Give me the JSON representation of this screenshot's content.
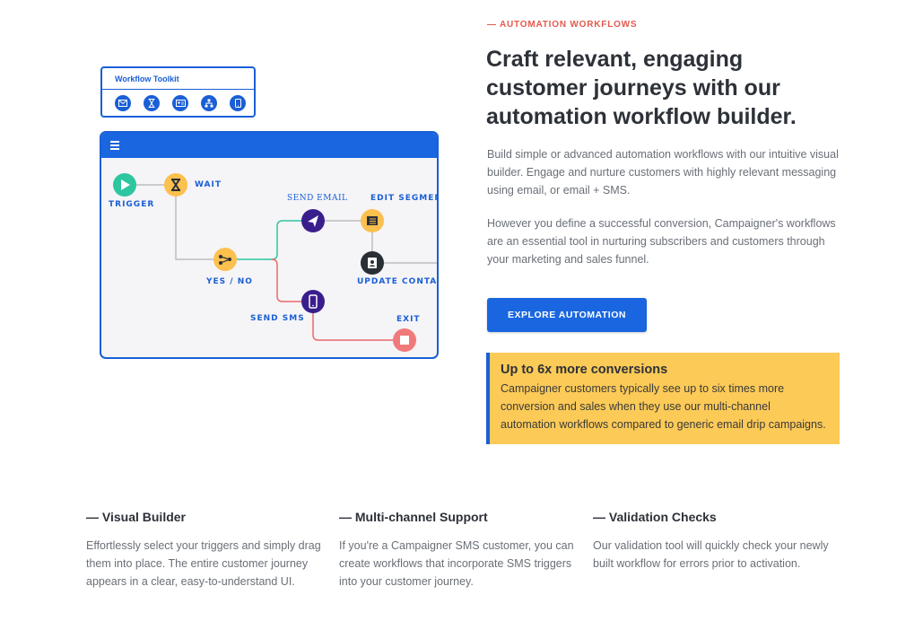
{
  "toolkit": {
    "title": "Workflow Toolkit",
    "icons": [
      "mail-icon",
      "hourglass-icon",
      "id-card-icon",
      "sitemap-icon",
      "mobile-icon"
    ]
  },
  "builder": {
    "nodes": {
      "trigger": "TRIGGER",
      "wait": "WAIT",
      "yes_no": "YES / NO",
      "send_email": "SEND EMAIL",
      "edit_segment": "EDIT SEGMENT",
      "update_contact": "UPDATE CONTACT",
      "send_sms": "SEND SMS",
      "exit": "EXIT"
    }
  },
  "content": {
    "eyebrow": "— AUTOMATION WORKFLOWS",
    "headline": "Craft relevant, engaging customer journeys with our automation workflow builder.",
    "paragraph1": "Build simple or advanced automation workflows with our intuitive visual builder. Engage and nurture customers with highly relevant messaging using email, or email + SMS.",
    "paragraph2": "However you define a successful conversion, Campaigner's workflows are an essential tool in nurturing subscribers and customers through your marketing and sales funnel.",
    "cta_label": "EXPLORE AUTOMATION"
  },
  "callout": {
    "title": "Up to 6x more conversions",
    "body": "Campaigner customers typically see up to six times more conversion and sales when they use our multi-channel automation workflows compared to generic email drip campaigns."
  },
  "features": [
    {
      "title": "— Visual Builder",
      "body": "Effortlessly select your triggers and simply drag them into place. The entire customer journey appears in a clear, easy-to-understand UI."
    },
    {
      "title": "— Multi-channel Support",
      "body": "If you're a Campaigner SMS customer, you can create workflows that incorporate SMS triggers into your customer journey."
    },
    {
      "title": "— Validation Checks",
      "body": "Our validation tool will quickly check your newly built workflow for errors prior to activation."
    }
  ],
  "colors": {
    "brand_blue": "#1a66e0",
    "accent_red": "#e35a4f",
    "callout_yellow": "#fcca57",
    "node_green": "#2dc6a0",
    "node_yellow": "#fcc04f",
    "node_purple": "#3a1f8c",
    "node_dark": "#2a2f36",
    "node_red": "#f07a7a"
  }
}
